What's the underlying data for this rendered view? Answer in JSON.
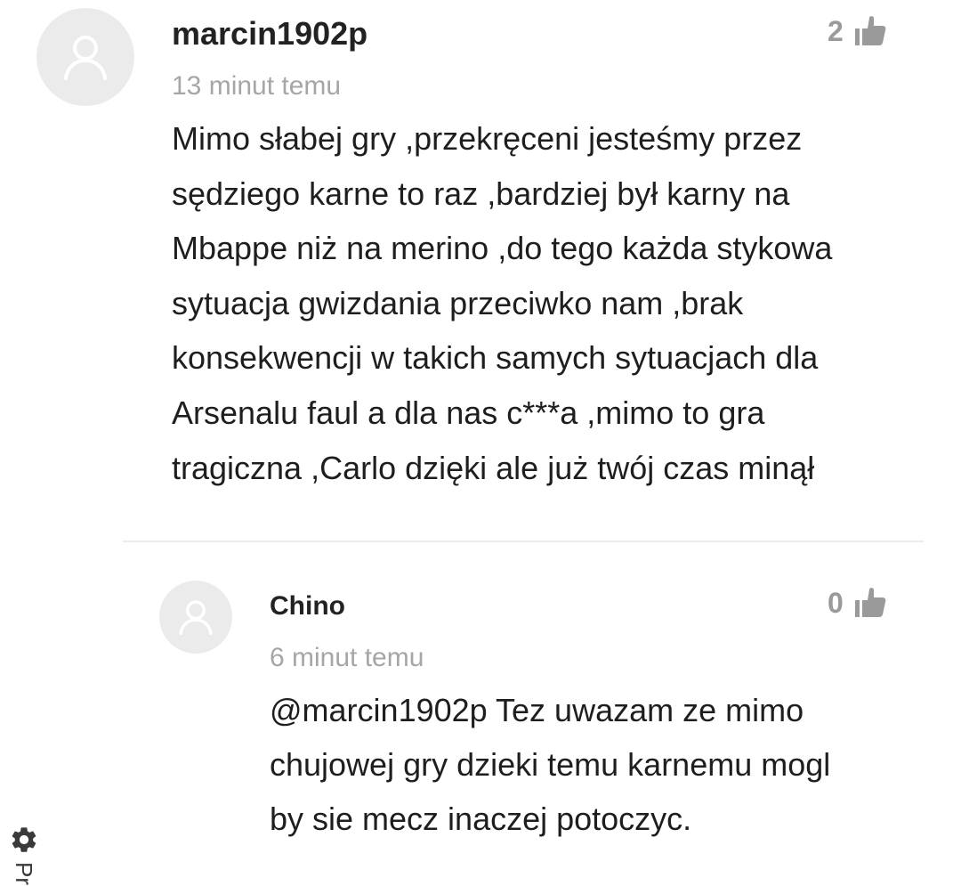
{
  "comments": [
    {
      "author": "marcin1902p",
      "time": "13 minut temu",
      "likes": "2",
      "lines": [
        "Mimo słabej gry ,przekręceni jesteśmy przez",
        "sędziego karne to raz ,bardziej był karny na",
        "Mbappe niż na merino ,do tego każda stykowa",
        "sytuacja gwizdania przeciwko nam ,brak",
        "konsekwencji w takich samych sytuacjach dla",
        "Arsenalu faul a dla nas c***a ,mimo to gra",
        "tragiczna ,Carlo dzięki ale już twój czas minął"
      ]
    },
    {
      "author": "Chino",
      "time": "6 minut temu",
      "likes": "0",
      "lines": [
        "@marcin1902p Tez uwazam ze mimo",
        "chujowej gry dzieki temu karnemu mogl",
        "by sie mecz inaczej potoczyc."
      ]
    }
  ],
  "privacy_tab": {
    "label": "Pr",
    "icon": "gear-icon"
  },
  "colors": {
    "avatar_bg": "#ebebeb",
    "avatar_fg": "#ffffff",
    "muted": "#a6a6a6",
    "text": "#1e1e1e"
  }
}
